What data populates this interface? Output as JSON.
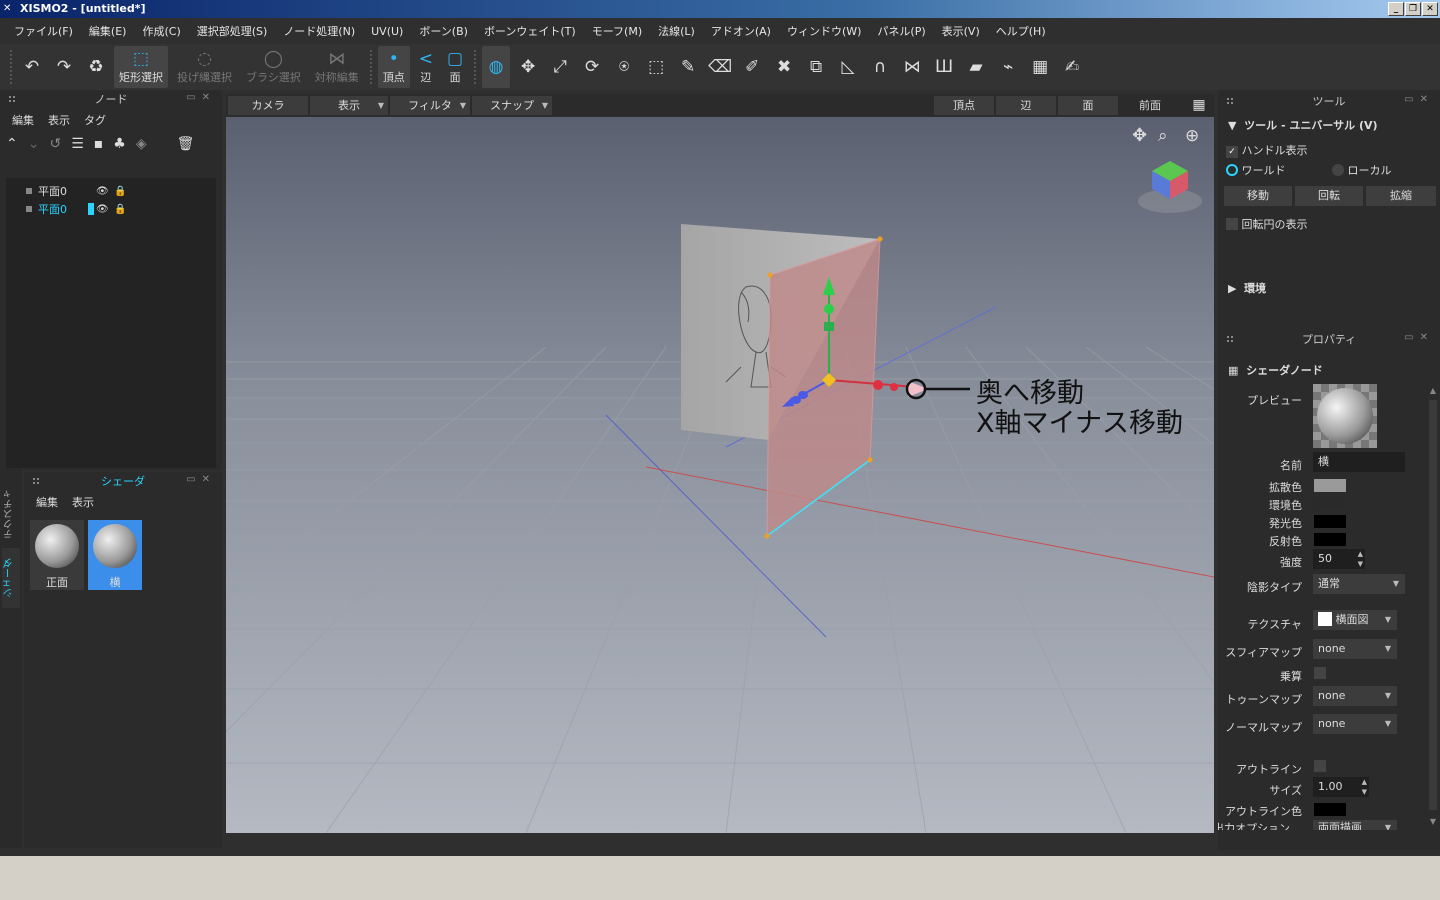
{
  "window": {
    "title": "XISMO2 - [untitled*]",
    "logo_icon": "xismo-logo-icon"
  },
  "menu": [
    "ファイル(F)",
    "編集(E)",
    "作成(C)",
    "選択部処理(S)",
    "ノード処理(N)",
    "UV(U)",
    "ボーン(B)",
    "ボーンウェイト(T)",
    "モーフ(M)",
    "法線(L)",
    "アドオン(A)",
    "ウィンドウ(W)",
    "パネル(P)",
    "表示(V)",
    "ヘルプ(H)"
  ],
  "toolbar": {
    "rect_select": "矩形選択",
    "lasso_select": "投げ縄選択",
    "brush_select": "ブラシ選択",
    "symmetric_edit": "対称編集",
    "vertex": "頂点",
    "edge": "辺",
    "face": "面"
  },
  "node_panel": {
    "title": "ノード",
    "menu": [
      "編集",
      "表示",
      "タグ"
    ],
    "items": [
      {
        "label": "平面0",
        "selected": false
      },
      {
        "label": "平面0",
        "selected": true
      }
    ]
  },
  "shader_panel": {
    "title": "シェーダ",
    "menu": [
      "編集",
      "表示"
    ],
    "swatches": [
      {
        "label": "正面",
        "selected": false
      },
      {
        "label": "横",
        "selected": true
      }
    ]
  },
  "side_tabs": [
    "テクスチャ",
    "シェーダ"
  ],
  "viewport_tabs": {
    "camera": "カメラ",
    "display": "表示",
    "filter": "フィルタ",
    "snap": "スナップ",
    "vertex": "頂点",
    "edge": "辺",
    "face": "面",
    "front": "前面"
  },
  "annotation": {
    "line1": "奥へ移動",
    "line2": "X軸マイナス移動"
  },
  "tool_panel": {
    "title": "ツール",
    "section": "ツール - ユニバーサル (V)",
    "show_handles": "ハンドル表示",
    "world": "ワールド",
    "local": "ローカル",
    "move": "移動",
    "rotate": "回転",
    "scale": "拡縮",
    "show_rotation_circle": "回転円の表示",
    "environment": "環境"
  },
  "properties": {
    "title": "プロパティ",
    "section": "シェーダノード",
    "preview": "プレビュー",
    "name_label": "名前",
    "name_value": "横",
    "diffuse": "拡散色",
    "ambient": "環境色",
    "emissive": "発光色",
    "specular": "反射色",
    "strength_label": "強度",
    "strength_value": "50",
    "shading_type_label": "陰影タイプ",
    "shading_type_value": "通常",
    "texture_label": "テクスチャ",
    "texture_value": "横面図",
    "sphere_map_label": "スフィアマップ",
    "sphere_map_value": "none",
    "multiply_label": "乗算",
    "toon_map_label": "トゥーンマップ",
    "toon_map_value": "none",
    "normal_map_label": "ノーマルマップ",
    "normal_map_value": "none",
    "outline_label": "アウトライン",
    "size_label": "サイズ",
    "size_value": "1.00",
    "outline_color_label": "アウトライン色",
    "output_option_label": "出力オプション",
    "output_option_value": "両面描画"
  },
  "colors": {
    "accent": "#2ad4ff",
    "diffuse": "#9a9a9a",
    "ambient": "#2a2a2a",
    "emissive": "#000000",
    "specular": "#000000",
    "outline": "#000000"
  }
}
